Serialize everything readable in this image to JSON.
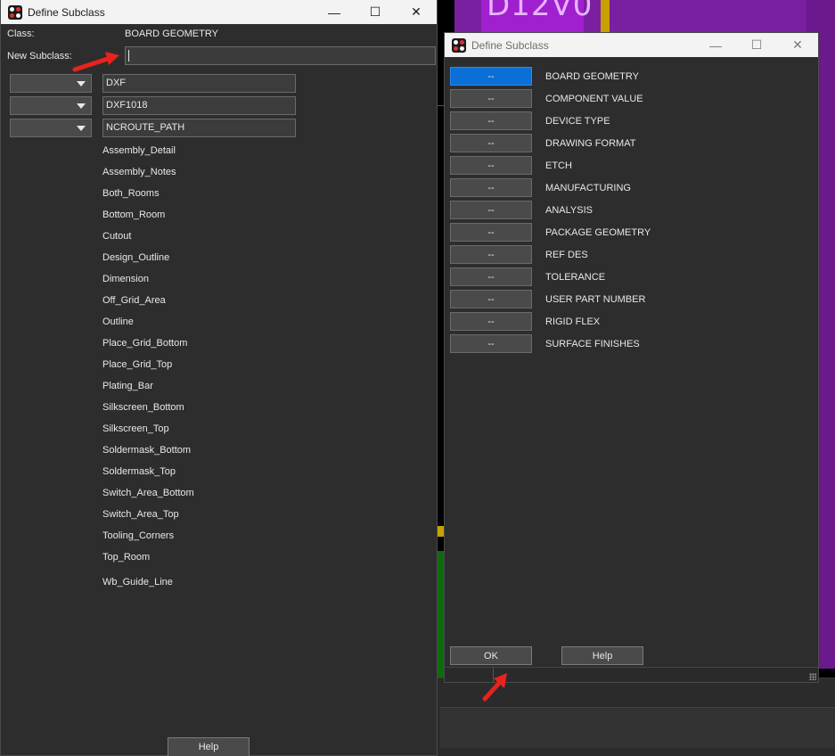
{
  "background": {
    "board_label": "D12V0",
    "colors": {
      "purple": "#a020d0",
      "dark_purple": "#6a1a8c",
      "yellow": "#c8a000",
      "green": "#0d6b0d"
    }
  },
  "left_dialog": {
    "title": "Define Subclass",
    "window_controls": {
      "minimize": "—",
      "maximize": "☐",
      "close": "✕"
    },
    "class_label": "Class:",
    "class_value": "BOARD GEOMETRY",
    "new_subclass_label": "New Subclass:",
    "new_subclass_value": "",
    "rows": [
      {
        "combo_value": "",
        "name": "DXF"
      },
      {
        "combo_value": "",
        "name": "DXF1018"
      },
      {
        "combo_value": "",
        "name": "NCROUTE_PATH"
      }
    ],
    "subclasses": [
      "Assembly_Detail",
      "Assembly_Notes",
      "Both_Rooms",
      "Bottom_Room",
      "Cutout",
      "Design_Outline",
      "Dimension",
      "Off_Grid_Area",
      "Outline",
      "Place_Grid_Bottom",
      "Place_Grid_Top",
      "Plating_Bar",
      "Silkscreen_Bottom",
      "Silkscreen_Top",
      "Soldermask_Bottom",
      "Soldermask_Top",
      "Switch_Area_Bottom",
      "Switch_Area_Top",
      "Tooling_Corners",
      "Top_Room",
      "Wb_Guide_Line"
    ],
    "help_label": "Help"
  },
  "right_dialog": {
    "title": "Define Subclass",
    "window_controls": {
      "minimize": "—",
      "maximize": "☐",
      "close": "✕"
    },
    "classes": [
      {
        "button": "--",
        "name": "BOARD GEOMETRY",
        "selected": true
      },
      {
        "button": "--",
        "name": "COMPONENT VALUE"
      },
      {
        "button": "--",
        "name": "DEVICE TYPE"
      },
      {
        "button": "--",
        "name": "DRAWING FORMAT"
      },
      {
        "button": "--",
        "name": "ETCH"
      },
      {
        "button": "--",
        "name": "MANUFACTURING"
      },
      {
        "button": "--",
        "name": "ANALYSIS"
      },
      {
        "button": "--",
        "name": "PACKAGE GEOMETRY"
      },
      {
        "button": "--",
        "name": "REF DES"
      },
      {
        "button": "--",
        "name": "TOLERANCE"
      },
      {
        "button": "--",
        "name": "USER PART NUMBER"
      },
      {
        "button": "--",
        "name": "RIGID FLEX"
      },
      {
        "button": "--",
        "name": "SURFACE FINISHES"
      }
    ],
    "ok_label": "OK",
    "help_label": "Help",
    "selected_color": "#0a6fd6"
  },
  "annotation_color": "#e8231e"
}
